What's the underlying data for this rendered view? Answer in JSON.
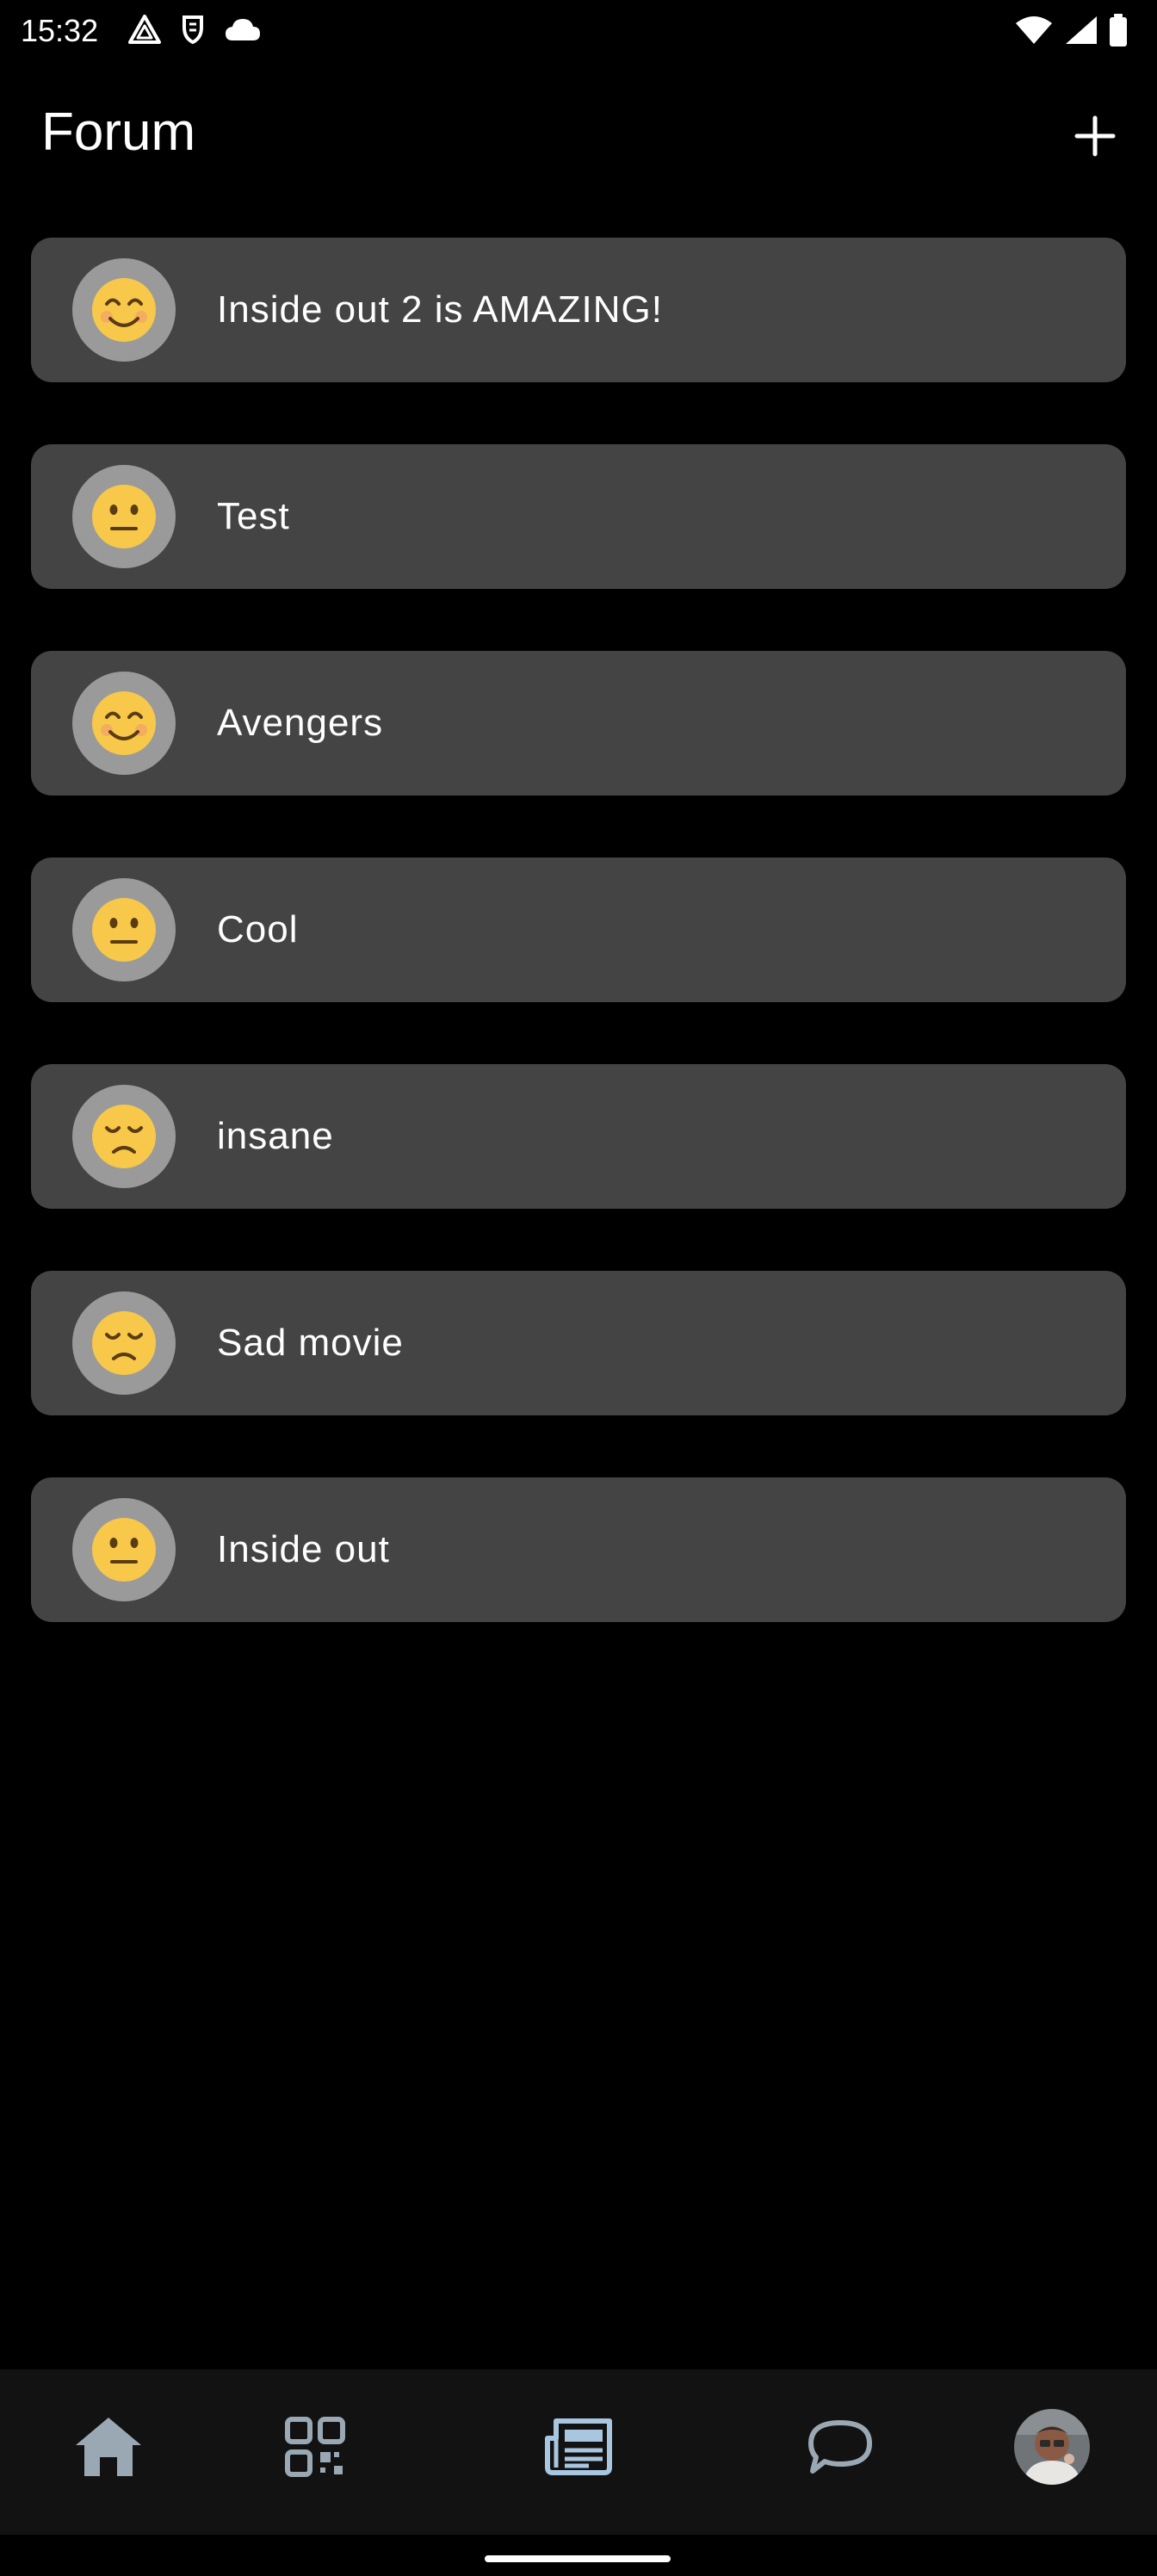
{
  "status_bar": {
    "time": "15:32",
    "left_icons": [
      "triangle-alert-icon",
      "shield-icon",
      "cloud-icon"
    ],
    "right_icons": [
      "wifi-icon",
      "signal-icon",
      "battery-icon"
    ]
  },
  "header": {
    "title": "Forum",
    "add_icon": "plus-icon"
  },
  "forum": {
    "items": [
      {
        "label": "Inside out 2 is AMAZING!",
        "mood": "happy"
      },
      {
        "label": "Test",
        "mood": "neutral"
      },
      {
        "label": "Avengers",
        "mood": "happy"
      },
      {
        "label": "Cool",
        "mood": "neutral"
      },
      {
        "label": "insane",
        "mood": "sad"
      },
      {
        "label": "Sad movie",
        "mood": "sad"
      },
      {
        "label": "Inside out",
        "mood": "neutral"
      }
    ]
  },
  "bottom_nav": {
    "items": [
      "home-icon",
      "qr-code-icon",
      "forum-icon",
      "chat-icon",
      "profile-avatar"
    ],
    "active": "forum-icon"
  },
  "colors": {
    "background": "#000000",
    "card": "#444444",
    "avatar_ring": "#9a9a9a",
    "nav_background": "#121212",
    "nav_active": "#a9c6e0",
    "nav_inactive": "#9aa8b4"
  }
}
